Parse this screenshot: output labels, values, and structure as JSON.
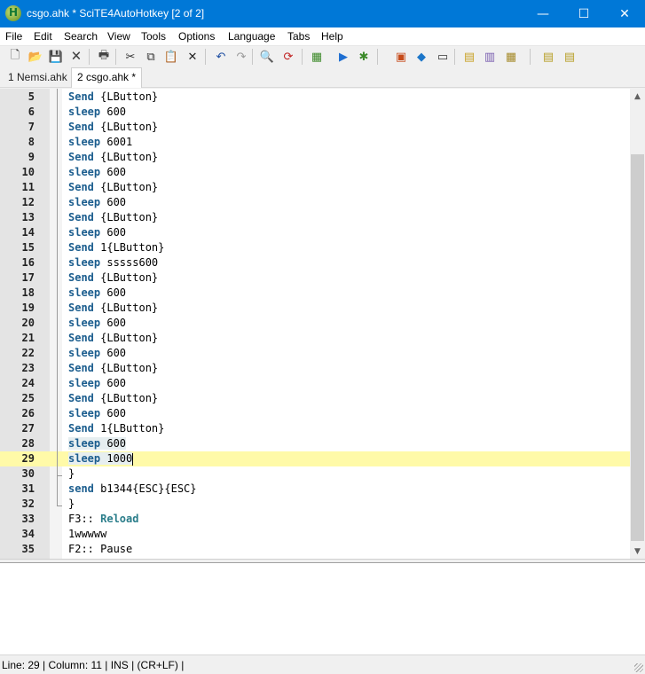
{
  "window": {
    "title": "csgo.ahk * SciTE4AutoHotkey [2 of 2]",
    "app_icon_glyph": "H",
    "controls": {
      "minimize": "—",
      "maximize": "☐",
      "close": "✕"
    }
  },
  "menu": [
    "File",
    "Edit",
    "Search",
    "View",
    "Tools",
    "Options",
    "Language",
    "Tabs",
    "Help"
  ],
  "toolbar": [
    {
      "name": "new-file-icon",
      "glyph": "🗋",
      "color": "#333333"
    },
    {
      "name": "open-folder-icon",
      "glyph": "📂",
      "color": "#c9a227"
    },
    {
      "name": "save-icon",
      "glyph": "💾",
      "color": "#1f3a7a"
    },
    {
      "name": "close-file-icon",
      "glyph": "🗙",
      "color": "#444444"
    },
    {
      "name": "print-icon",
      "glyph": "🖶",
      "color": "#444444"
    },
    {
      "name": "cut-icon",
      "glyph": "✂",
      "color": "#333333"
    },
    {
      "name": "copy-icon",
      "glyph": "⧉",
      "color": "#333333"
    },
    {
      "name": "paste-icon",
      "glyph": "📋",
      "color": "#8a6d2b"
    },
    {
      "name": "delete-icon",
      "glyph": "✕",
      "color": "#222222"
    },
    {
      "name": "undo-icon",
      "glyph": "↶",
      "color": "#1f4fa3"
    },
    {
      "name": "redo-icon",
      "glyph": "↷",
      "color": "#9a9a9a"
    },
    {
      "name": "find-icon",
      "glyph": "🔍",
      "color": "#333333"
    },
    {
      "name": "replace-icon",
      "glyph": "⟳",
      "color": "#c02020"
    },
    {
      "name": "compile-icon",
      "glyph": "▦",
      "color": "#3d8a2a"
    },
    {
      "name": "run-icon",
      "glyph": "▶",
      "color": "#1f6fd1"
    },
    {
      "name": "debug-icon",
      "glyph": "✱",
      "color": "#3c8a2a"
    },
    {
      "name": "properties-icon",
      "glyph": "▣",
      "color": "#c64a1a"
    },
    {
      "name": "cube-icon",
      "glyph": "◆",
      "color": "#1c76c9"
    },
    {
      "name": "window-icon",
      "glyph": "▭",
      "color": "#333333"
    },
    {
      "name": "script-icon",
      "glyph": "▤",
      "color": "#c9a227"
    },
    {
      "name": "script-edit-icon",
      "glyph": "▥",
      "color": "#7a5fb0"
    },
    {
      "name": "script-settings-icon",
      "glyph": "▦",
      "color": "#a58a2a"
    },
    {
      "name": "notes-icon",
      "glyph": "▤",
      "color": "#b8a02a"
    },
    {
      "name": "notes-edit-icon",
      "glyph": "▤",
      "color": "#b8a02a"
    }
  ],
  "tabs": [
    {
      "label": "1 Nemsi.ahk",
      "active": false
    },
    {
      "label": "2 csgo.ahk *",
      "active": true
    }
  ],
  "editor": {
    "current_line": 29,
    "lines": [
      {
        "n": "5",
        "kw": "Send",
        "kwc": "kw",
        "rest": " {LButton}"
      },
      {
        "n": "6",
        "kw": "sleep",
        "kwc": "kw",
        "rest": " 600"
      },
      {
        "n": "7",
        "kw": "Send",
        "kwc": "kw",
        "rest": " {LButton}"
      },
      {
        "n": "8",
        "kw": "sleep",
        "kwc": "kw",
        "rest": " 6001"
      },
      {
        "n": "9",
        "kw": "Send",
        "kwc": "kw",
        "rest": " {LButton}"
      },
      {
        "n": "10",
        "kw": "sleep",
        "kwc": "kw",
        "rest": " 600"
      },
      {
        "n": "11",
        "kw": "Send",
        "kwc": "kw",
        "rest": " {LButton}"
      },
      {
        "n": "12",
        "kw": "sleep",
        "kwc": "kw",
        "rest": " 600"
      },
      {
        "n": "13",
        "kw": "Send",
        "kwc": "kw",
        "rest": " {LButton}"
      },
      {
        "n": "14",
        "kw": "sleep",
        "kwc": "kw",
        "rest": " 600"
      },
      {
        "n": "15",
        "kw": "Send",
        "kwc": "kw",
        "rest": " 1{LButton}"
      },
      {
        "n": "16",
        "kw": "sleep",
        "kwc": "kw",
        "rest": " sssss600"
      },
      {
        "n": "17",
        "kw": "Send",
        "kwc": "kw",
        "rest": " {LButton}"
      },
      {
        "n": "18",
        "kw": "sleep",
        "kwc": "kw",
        "rest": " 600"
      },
      {
        "n": "19",
        "kw": "Send",
        "kwc": "kw",
        "rest": " {LButton}"
      },
      {
        "n": "20",
        "kw": "sleep",
        "kwc": "kw",
        "rest": " 600"
      },
      {
        "n": "21",
        "kw": "Send",
        "kwc": "kw",
        "rest": " {LButton}"
      },
      {
        "n": "22",
        "kw": "sleep",
        "kwc": "kw",
        "rest": " 600"
      },
      {
        "n": "23",
        "kw": "Send",
        "kwc": "kw",
        "rest": " {LButton}"
      },
      {
        "n": "24",
        "kw": "sleep",
        "kwc": "kw",
        "rest": " 600"
      },
      {
        "n": "25",
        "kw": "Send",
        "kwc": "kw",
        "rest": " {LButton}"
      },
      {
        "n": "26",
        "kw": "sleep",
        "kwc": "kw",
        "rest": " 600"
      },
      {
        "n": "27",
        "kw": "Send",
        "kwc": "kw",
        "rest": " 1{LButton}"
      },
      {
        "n": "28",
        "kw": "sleep",
        "kwc": "kw",
        "rest": " 600",
        "selected": true
      },
      {
        "n": "29",
        "kw": "sleep",
        "kwc": "kw",
        "rest": " 1000",
        "selected": true,
        "caret": true
      },
      {
        "n": "30",
        "kw": "",
        "kwc": "",
        "rest": "}"
      },
      {
        "n": "31",
        "kw": "send",
        "kwc": "kw",
        "rest": " b1344{ESC}{ESC}"
      },
      {
        "n": "32",
        "kw": "",
        "kwc": "",
        "rest": "}"
      },
      {
        "n": "33",
        "kw": "",
        "kwc": "",
        "rest": "F3::",
        "tail": " Reload",
        "tailc": "kw2"
      },
      {
        "n": "34",
        "kw": "",
        "kwc": "",
        "rest": "1wwwww"
      },
      {
        "n": "35",
        "kw": "",
        "kwc": "",
        "rest": "F2:: Pause"
      }
    ]
  },
  "scrollbar": {
    "up": "▲",
    "down": "▼"
  },
  "status": {
    "text": "Line: 29 | Column: 11 | INS | (CR+LF) |"
  },
  "colors": {
    "titlebar": "#0078d7",
    "current_line": "#fffaa8",
    "keyword": "#1b5d8e"
  }
}
